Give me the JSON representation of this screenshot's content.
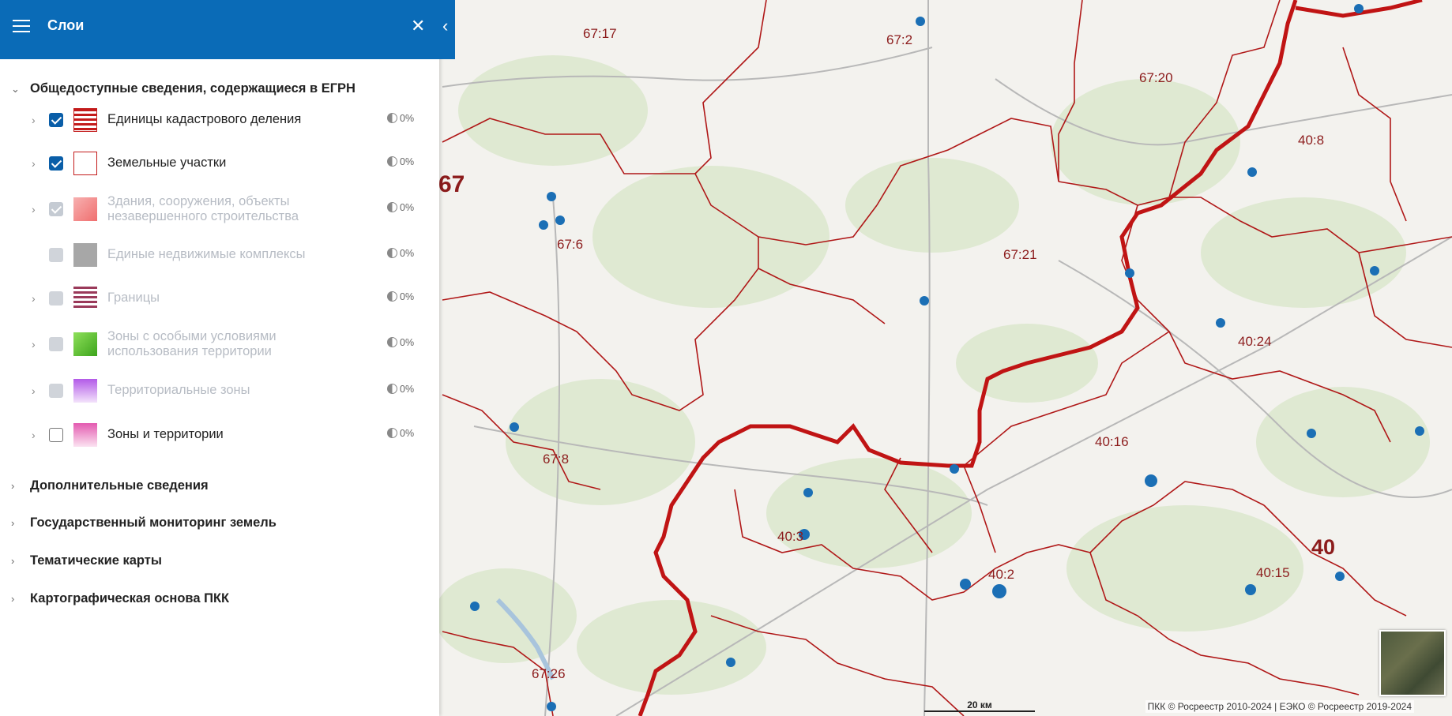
{
  "panel": {
    "title": "Слои",
    "groups": [
      {
        "label": "Общедоступные сведения, содержащиеся в ЕГРН",
        "expanded": true
      },
      {
        "label": "Дополнительные сведения",
        "expanded": false
      },
      {
        "label": "Государственный мониторинг земель",
        "expanded": false
      },
      {
        "label": "Тематические карты",
        "expanded": false
      },
      {
        "label": "Картографическая основа ПКК",
        "expanded": false
      }
    ],
    "layers": [
      {
        "label": "Единицы кадастрового деления",
        "checked": true,
        "enabled": true,
        "opacity": "0%",
        "expandable": true,
        "swatch": "cadastral-division-swatch"
      },
      {
        "label": "Земельные участки",
        "checked": true,
        "enabled": true,
        "opacity": "0%",
        "expandable": true,
        "swatch": "land-plots-swatch"
      },
      {
        "label": "Здания, сооружения, объекты незавершенного строительства",
        "checked": true,
        "enabled": false,
        "opacity": "0%",
        "expandable": true,
        "swatch": "buildings-swatch"
      },
      {
        "label": "Единые недвижимые комплексы",
        "checked": false,
        "enabled": false,
        "opacity": "0%",
        "expandable": false,
        "swatch": "complexes-swatch"
      },
      {
        "label": "Границы",
        "checked": false,
        "enabled": false,
        "opacity": "0%",
        "expandable": true,
        "swatch": "borders-swatch"
      },
      {
        "label": "Зоны с особыми условиями использования территории",
        "checked": false,
        "enabled": false,
        "opacity": "0%",
        "expandable": true,
        "swatch": "special-zones-swatch"
      },
      {
        "label": "Территориальные зоны",
        "checked": false,
        "enabled": false,
        "opacity": "0%",
        "expandable": true,
        "swatch": "territorial-zones-swatch"
      },
      {
        "label": "Зоны и территории",
        "checked": false,
        "enabled": true,
        "opacity": "0%",
        "expandable": true,
        "swatch": "zones-territories-swatch"
      }
    ]
  },
  "map": {
    "labels": [
      "67:17",
      "67:2",
      "67:20",
      "40:8",
      "67",
      "67:6",
      "67:21",
      "40:24",
      "67:8",
      "40:16",
      "40:3",
      "40:2",
      "40:15",
      "40",
      "67:26"
    ],
    "scale_label": "20 км",
    "attribution": "ПКК © Росреестр 2010-2024 | ЕЭКО © Росреестр 2019-2024"
  },
  "colors": {
    "header": "#0a6bb7",
    "boundary": "#b01818",
    "marker": "#1b6fb5"
  }
}
